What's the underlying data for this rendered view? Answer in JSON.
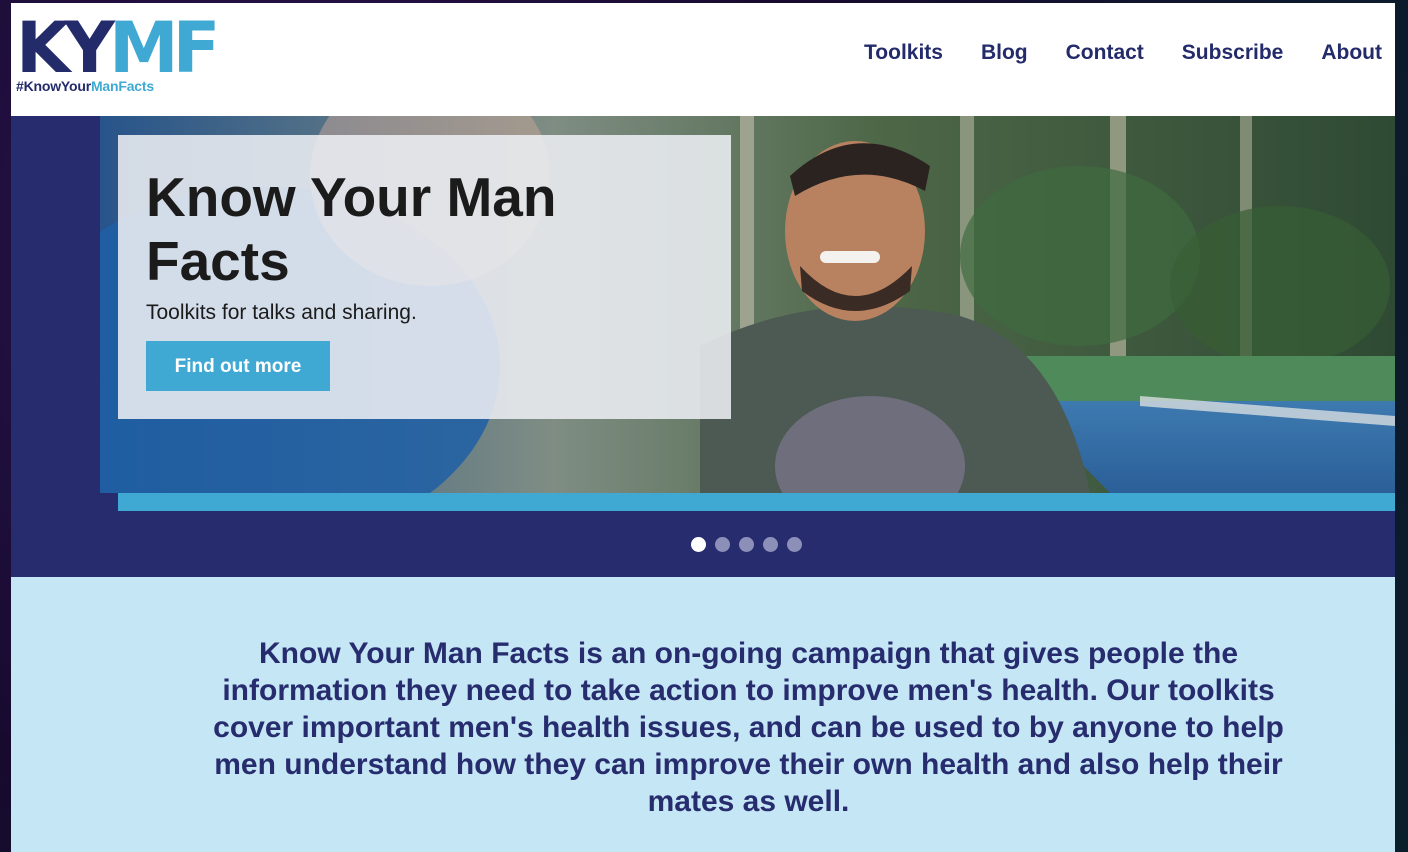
{
  "colors": {
    "navy": "#262c6d",
    "accent_blue": "#3fa9d3",
    "light_blue_bg": "#c5e6f4",
    "white": "#ffffff"
  },
  "logo": {
    "mark_part1": "KY",
    "mark_part2": "MF",
    "tag_part1": "#KnowYour",
    "tag_part2": "ManFacts"
  },
  "nav": {
    "items": [
      {
        "label": "Toolkits"
      },
      {
        "label": "Blog"
      },
      {
        "label": "Contact"
      },
      {
        "label": "Subscribe"
      },
      {
        "label": "About"
      }
    ]
  },
  "hero": {
    "title": "Know Your Man Facts",
    "subtitle": "Toolkits for talks and sharing.",
    "button_label": "Find out more",
    "slides": {
      "count": 5,
      "active_index": 0
    }
  },
  "intro": {
    "text": "Know Your Man Facts is an on-going campaign that gives people the information they need to take action to improve men's health. Our toolkits cover important men's health issues, and can be used to by anyone to help men understand how they can improve their own health and also help their mates as well."
  }
}
